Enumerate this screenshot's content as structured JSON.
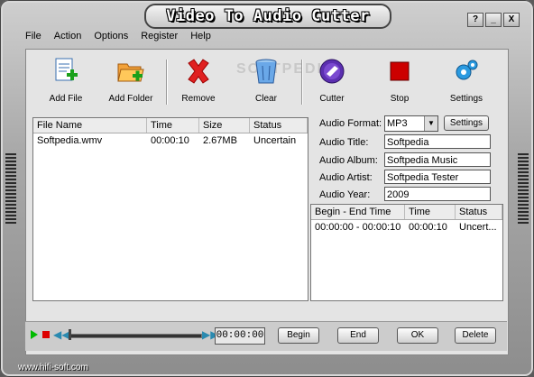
{
  "window": {
    "title": "Video To Audio Cutter",
    "buttons": [
      "?",
      "_",
      "X"
    ]
  },
  "menu": [
    "File",
    "Action",
    "Options",
    "Register",
    "Help"
  ],
  "watermark": "SOFTPEDIA",
  "toolbar": [
    {
      "label": "Add File",
      "icon": "add-file-icon"
    },
    {
      "label": "Add Folder",
      "icon": "add-folder-icon"
    },
    {
      "label": "Remove",
      "icon": "remove-icon"
    },
    {
      "label": "Clear",
      "icon": "clear-icon"
    },
    {
      "label": "Cutter",
      "icon": "cutter-icon"
    },
    {
      "label": "Stop",
      "icon": "stop-icon"
    },
    {
      "label": "Settings",
      "icon": "settings-icon"
    }
  ],
  "file_list": {
    "columns": [
      "File Name",
      "Time",
      "Size",
      "Status"
    ],
    "rows": [
      {
        "name": "Softpedia.wmv",
        "time": "00:00:10",
        "size": "2.67MB",
        "status": "Uncertain"
      }
    ]
  },
  "audio": {
    "format_label": "Audio Format:",
    "format_value": "MP3",
    "settings_label": "Settings",
    "title_label": "Audio Title:",
    "title_value": "Softpedia",
    "album_label": "Audio Album:",
    "album_value": "Softpedia Music",
    "artist_label": "Audio Artist:",
    "artist_value": "Softpedia Tester",
    "year_label": "Audio Year:",
    "year_value": "2009"
  },
  "segments": {
    "columns": [
      "Begin - End Time",
      "Time",
      "Status"
    ],
    "rows": [
      {
        "range": "00:00:00 - 00:00:10",
        "time": "00:00:10",
        "status": "Uncert..."
      }
    ]
  },
  "player": {
    "time": "00:00:00",
    "begin_label": "Begin",
    "end_label": "End",
    "ok_label": "OK",
    "delete_label": "Delete"
  },
  "footer": "www.hifi-soft.com",
  "colors": {
    "accent_red": "#dd0000",
    "play_green": "#00bb00"
  }
}
